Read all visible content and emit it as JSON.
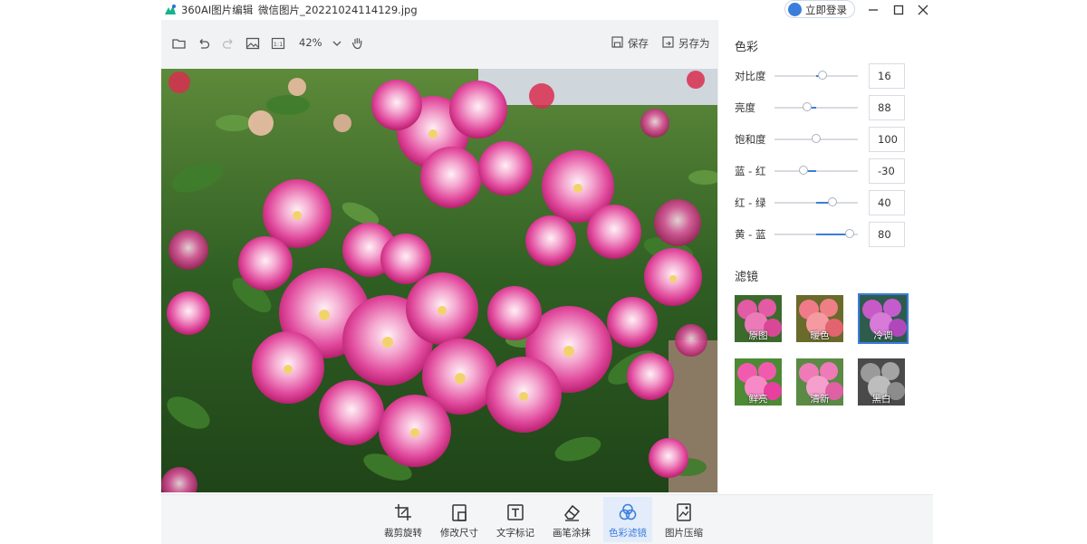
{
  "titlebar": {
    "app_name": "360AI图片编辑",
    "file_name": "微信图片_20221024114129.jpg",
    "login_label": "立即登录"
  },
  "toolbar": {
    "zoom_level": "42%",
    "save_label": "保存",
    "save_as_label": "另存为"
  },
  "color_panel": {
    "title": "色彩",
    "adjustments": [
      {
        "label": "对比度",
        "value": "16",
        "fraction": 0.58
      },
      {
        "label": "亮度",
        "value": "88",
        "fraction": 0.39
      },
      {
        "label": "饱和度",
        "value": "100",
        "fraction": 0.5
      },
      {
        "label": "蓝 - 红",
        "value": "-30",
        "fraction": 0.35
      },
      {
        "label": "红 - 绿",
        "value": "40",
        "fraction": 0.7
      },
      {
        "label": "黄 - 蓝",
        "value": "80",
        "fraction": 0.9
      }
    ]
  },
  "filter_panel": {
    "title": "滤镜",
    "filters": [
      {
        "label": "原图",
        "selected": false
      },
      {
        "label": "暖色",
        "selected": false
      },
      {
        "label": "冷调",
        "selected": true
      },
      {
        "label": "鲜亮",
        "selected": false
      },
      {
        "label": "清新",
        "selected": false
      },
      {
        "label": "黑白",
        "selected": false
      }
    ]
  },
  "bottom_tools": [
    {
      "label": "裁剪旋转",
      "icon": "crop-rotate-icon"
    },
    {
      "label": "修改尺寸",
      "icon": "resize-icon"
    },
    {
      "label": "文字标记",
      "icon": "text-icon"
    },
    {
      "label": "画笔涂抹",
      "icon": "eraser-icon"
    },
    {
      "label": "色彩滤镜",
      "icon": "color-filter-icon",
      "active": true
    },
    {
      "label": "图片压缩",
      "icon": "compress-icon"
    }
  ],
  "colors": {
    "accent": "#3b7ddd",
    "toolbar_bg": "#f1f2f4"
  }
}
